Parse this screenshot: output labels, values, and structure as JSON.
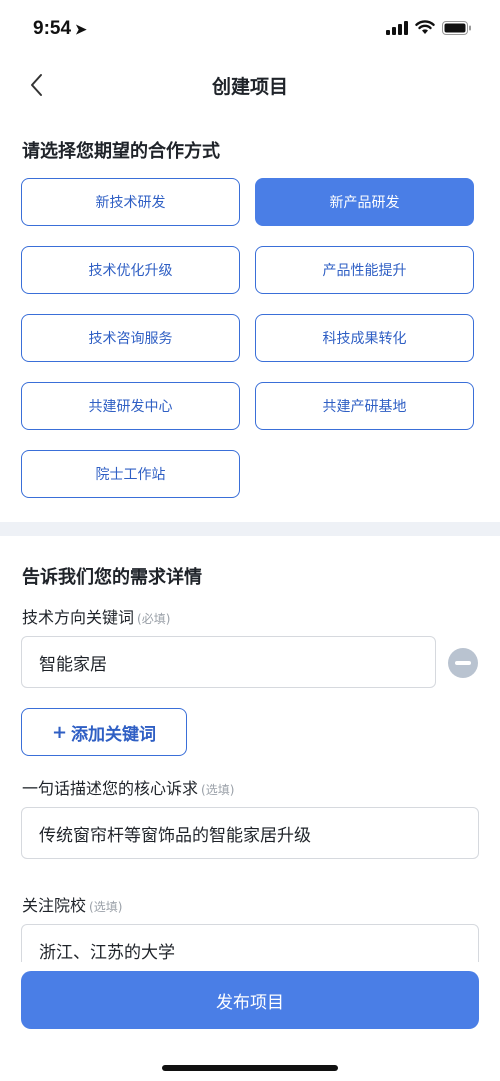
{
  "status": {
    "time": "9:54",
    "location_icon": "location-arrow-icon",
    "signal_icon": "signal-icon",
    "wifi_icon": "wifi-icon",
    "battery_icon": "battery-icon"
  },
  "nav": {
    "back_icon": "chevron-left-icon",
    "title": "创建项目"
  },
  "cooperation": {
    "title": "请选择您期望的合作方式",
    "options": [
      {
        "label": "新技术研发",
        "selected": false
      },
      {
        "label": "新产品研发",
        "selected": true
      },
      {
        "label": "技术优化升级",
        "selected": false
      },
      {
        "label": "产品性能提升",
        "selected": false
      },
      {
        "label": "技术咨询服务",
        "selected": false
      },
      {
        "label": "科技成果转化",
        "selected": false
      },
      {
        "label": "共建研发中心",
        "selected": false
      },
      {
        "label": "共建产研基地",
        "selected": false
      },
      {
        "label": "院士工作站",
        "selected": false
      }
    ]
  },
  "details": {
    "title": "告诉我们您的需求详情",
    "keyword": {
      "label": "技术方向关键词",
      "hint": "(必填)",
      "value": "智能家居",
      "remove_icon": "minus-circle-icon"
    },
    "add_keyword": {
      "plus": "+",
      "label": "添加关键词"
    },
    "core_need": {
      "label": "一句话描述您的核心诉求",
      "hint": "(选填)",
      "value": "传统窗帘杆等窗饰品的智能家居升级"
    },
    "school": {
      "label": "关注院校",
      "hint": "(选填)",
      "value": "浙江、江苏的大学"
    }
  },
  "publish": {
    "label": "发布项目"
  },
  "colors": {
    "accent": "#4a7ee6",
    "border_accent": "#3a6fd8",
    "muted": "#9aa0a8"
  }
}
